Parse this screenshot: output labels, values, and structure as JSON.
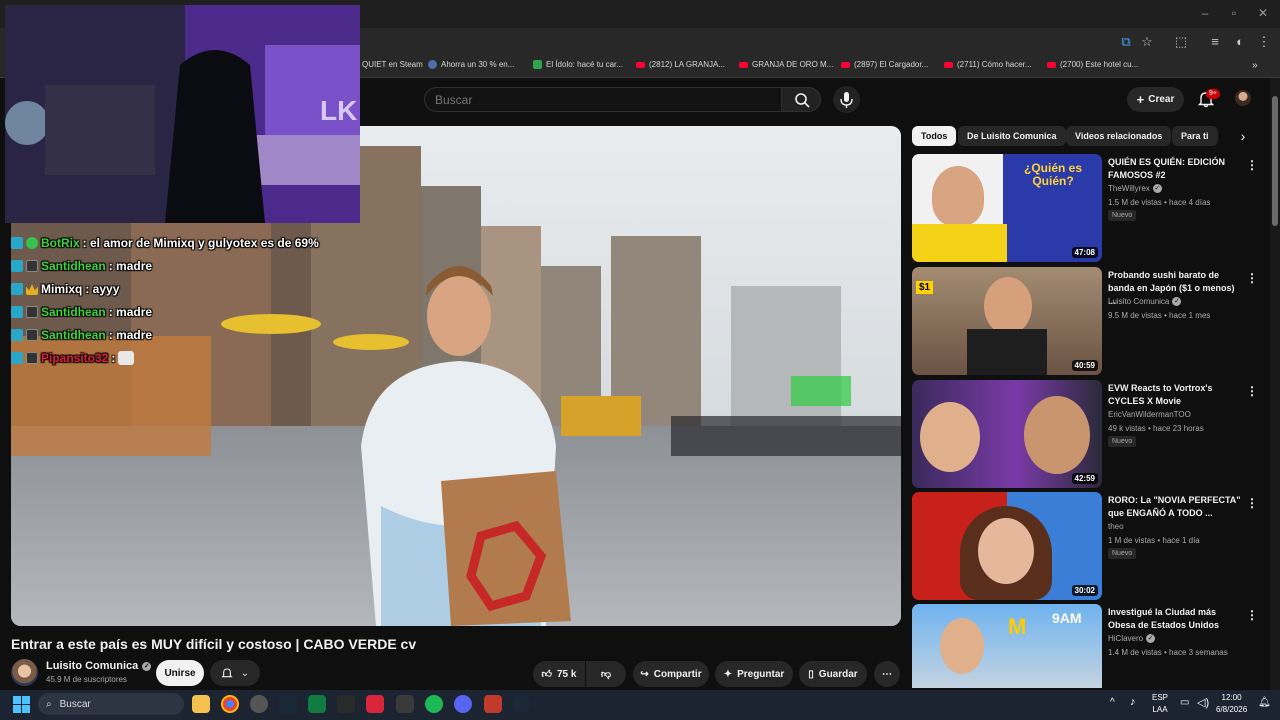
{
  "browser": {
    "bookmarks": [
      {
        "label": "QUIET en Steam",
        "icon": "steam-icon"
      },
      {
        "label": "Ahorra un 30 % en...",
        "icon": "steam-icon"
      },
      {
        "label": "El Ídolo: hacé tu car...",
        "icon": "bookmark-icon"
      },
      {
        "label": "(2812) LA GRANJA...",
        "icon": "youtube-icon"
      },
      {
        "label": "GRANJA DE ORO M...",
        "icon": "youtube-icon"
      },
      {
        "label": "(2897) El Cargador...",
        "icon": "youtube-icon"
      },
      {
        "label": "(2711) Cómo hacer...",
        "icon": "youtube-icon"
      },
      {
        "label": "(2700) Este hotel cu...",
        "icon": "youtube-icon"
      }
    ]
  },
  "header": {
    "search_placeholder": "Buscar",
    "create_label": "Crear",
    "notifications_badge": "9+"
  },
  "chat": [
    {
      "user": "BotRix",
      "color": "#3cd73c",
      "message": ": el amor de Mimixq y gulyotex es de 69%",
      "badges": [
        "b-mod",
        "b-check"
      ]
    },
    {
      "user": "Santidhean",
      "color": "#3cd73c",
      "message": ": madre",
      "badges": [
        "b-mod",
        "b-ctrl"
      ]
    },
    {
      "user": "Mimixq",
      "color": "#ffffff",
      "message": ": ayyy",
      "badges": [
        "b-mod",
        "b-crown"
      ]
    },
    {
      "user": "Santidhean",
      "color": "#3cd73c",
      "message": ": madre",
      "badges": [
        "b-mod",
        "b-ctrl"
      ]
    },
    {
      "user": "Santidhean",
      "color": "#3cd73c",
      "message": ": madre",
      "badges": [
        "b-mod",
        "b-ctrl"
      ]
    },
    {
      "user": "Pipansito32",
      "color": "#e0203a",
      "message": ":",
      "badges": [
        "b-mod",
        "b-ctrl"
      ]
    }
  ],
  "video": {
    "title": "Entrar a este país es MUY difícil y costoso | CABO VERDE cv",
    "channel": "Luisito Comunica",
    "subscribers": "45.9 M de suscriptores",
    "join_label": "Unirse",
    "likes": "75 k",
    "share_label": "Compartir",
    "ask_label": "Preguntar",
    "save_label": "Guardar"
  },
  "chips": [
    {
      "label": "Todos",
      "active": true
    },
    {
      "label": "De Luisito Comunica",
      "active": false
    },
    {
      "label": "Videos relacionados",
      "active": false
    },
    {
      "label": "Para ti",
      "active": false
    }
  ],
  "recommendations": [
    {
      "title": "QUIÉN ES QUIÉN: EDICIÓN FAMOSOS #2",
      "channel": "TheWillyrex",
      "verified": true,
      "meta": "1.5 M de vistas • hace 4 días",
      "badge": "Nuevo",
      "duration": "47:08",
      "thumb_text": "¿Quién es Quién?"
    },
    {
      "title": "Probando sushi barato de banda en Japón ($1 o menos) ...",
      "channel": "Luisito Comunica",
      "verified": true,
      "meta": "9.5 M de vistas • hace 1 mes",
      "badge": "",
      "duration": "40:59",
      "thumb_text": "$1"
    },
    {
      "title": "EVW Reacts to Vortrox's CYCLES X Movie",
      "channel": "EricVanWildermanTOO",
      "verified": false,
      "meta": "49 k vistas • hace 23 horas",
      "badge": "Nuevo",
      "duration": "42:59",
      "thumb_text": ""
    },
    {
      "title": "RORO: La \"NOVIA PERFECTA\" que ENGAÑÓ A TODO ...",
      "channel": "theo",
      "verified": false,
      "meta": "1 M de vistas • hace 1 día",
      "badge": "Nuevo",
      "duration": "30:02",
      "thumb_text": ""
    },
    {
      "title": "Investigué la Ciudad más Obesa de Estados Unidos",
      "channel": "HiClavero",
      "verified": true,
      "meta": "1.4 M de vistas • hace 3 semanas",
      "badge": "",
      "duration": "",
      "thumb_text": "9AM"
    }
  ],
  "taskbar": {
    "search_label": "Buscar",
    "lang_line1": "ESP",
    "lang_line2": "LAA",
    "time": "12:00",
    "date": "6/8/2026"
  }
}
